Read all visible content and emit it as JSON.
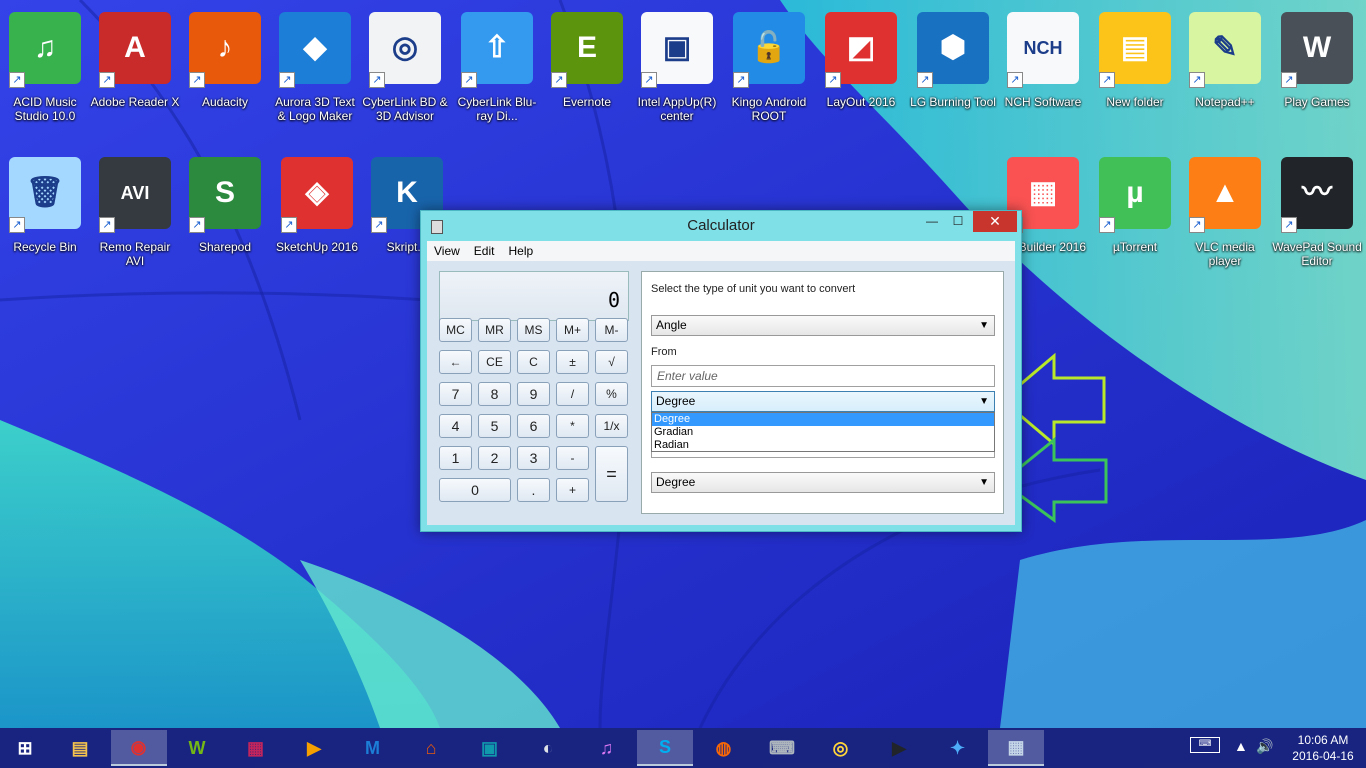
{
  "desktop": {
    "row1": [
      {
        "label": "ACID Music Studio 10.0",
        "color": "#37b24d",
        "glyph": "♫"
      },
      {
        "label": "Adobe Reader X",
        "color": "#c92a2a",
        "glyph": "A"
      },
      {
        "label": "Audacity",
        "color": "#e8590c",
        "glyph": "♪"
      },
      {
        "label": "Aurora 3D Text & Logo Maker",
        "color": "#1c7ed6",
        "glyph": "◆"
      },
      {
        "label": "CyberLink BD & 3D Advisor",
        "color": "#f1f3f5",
        "glyph": "◎"
      },
      {
        "label": "CyberLink Blu-ray Di...",
        "color": "#339af0",
        "glyph": "⇧"
      },
      {
        "label": "Evernote",
        "color": "#5c940d",
        "glyph": "E"
      },
      {
        "label": "Intel AppUp(R) center",
        "color": "#f8f9fa",
        "glyph": "▣"
      },
      {
        "label": "Kingo Android ROOT",
        "color": "#228be6",
        "glyph": "🔓"
      },
      {
        "label": "LayOut 2016",
        "color": "#e03131",
        "glyph": "◩"
      },
      {
        "label": "LG Burning Tool",
        "color": "#1971c2",
        "glyph": "⬢"
      },
      {
        "label": "NCH Software",
        "color": "#f8f9fa",
        "glyph": "NCH"
      },
      {
        "label": "New folder",
        "color": "#fcc419",
        "glyph": "▤"
      },
      {
        "label": "Notepad++",
        "color": "#d8f5a2",
        "glyph": "✎"
      },
      {
        "label": "Play Games",
        "color": "#495057",
        "glyph": "W"
      }
    ],
    "row2": [
      {
        "label": "Recycle Bin",
        "color": "#a5d8ff",
        "glyph": "🗑"
      },
      {
        "label": "Remo Repair AVI",
        "color": "#343a40",
        "glyph": "AVI"
      },
      {
        "label": "Sharepod",
        "color": "#2b8a3e",
        "glyph": "S"
      },
      {
        "label": "SketchUp 2016",
        "color": "#e03131",
        "glyph": "◈"
      },
      {
        "label": "Skript.e",
        "color": "#1864ab",
        "glyph": "K"
      }
    ],
    "row2_right": [
      {
        "label": "yle Builder 2016",
        "color": "#fa5252",
        "glyph": "▦"
      },
      {
        "label": "µTorrent",
        "color": "#40c057",
        "glyph": "µ"
      },
      {
        "label": "VLC media player",
        "color": "#fd7e14",
        "glyph": "▲"
      },
      {
        "label": "WavePad Sound Editor",
        "color": "#212529",
        "glyph": "〰"
      }
    ]
  },
  "calculator": {
    "title": "Calculator",
    "window_buttons": {
      "minimize": "—",
      "maximize": "☐",
      "close": "✕"
    },
    "menu": [
      "View",
      "Edit",
      "Help"
    ],
    "display": "0",
    "keys": {
      "memory": [
        "MC",
        "MR",
        "MS",
        "M+",
        "M-"
      ],
      "row2": [
        "←",
        "CE",
        "C",
        "±",
        "√"
      ],
      "row3": [
        "7",
        "8",
        "9",
        "/",
        "%"
      ],
      "row4": [
        "4",
        "5",
        "6",
        "*",
        "1/x"
      ],
      "row5": [
        "1",
        "2",
        "3",
        "-"
      ],
      "row6": [
        "0",
        ".",
        "+"
      ],
      "equals": "="
    },
    "converter": {
      "prompt": "Select the type of unit you want to convert",
      "unit_type": "Angle",
      "from_label": "From",
      "from_placeholder": "Enter value",
      "from_unit": "Degree",
      "dropdown_options": [
        "Degree",
        "Gradian",
        "Radian"
      ],
      "to_unit": "Degree"
    }
  },
  "taskbar": {
    "items": [
      "start",
      "explorer",
      "chrome",
      "winamp",
      "winrar",
      "media",
      "malwarebytes",
      "app",
      "video",
      "app2",
      "itunes",
      "skype",
      "firefox",
      "network",
      "cam",
      "player",
      "safari",
      "calculator"
    ],
    "clock_time": "10:06 AM",
    "clock_date": "2016-04-16"
  }
}
